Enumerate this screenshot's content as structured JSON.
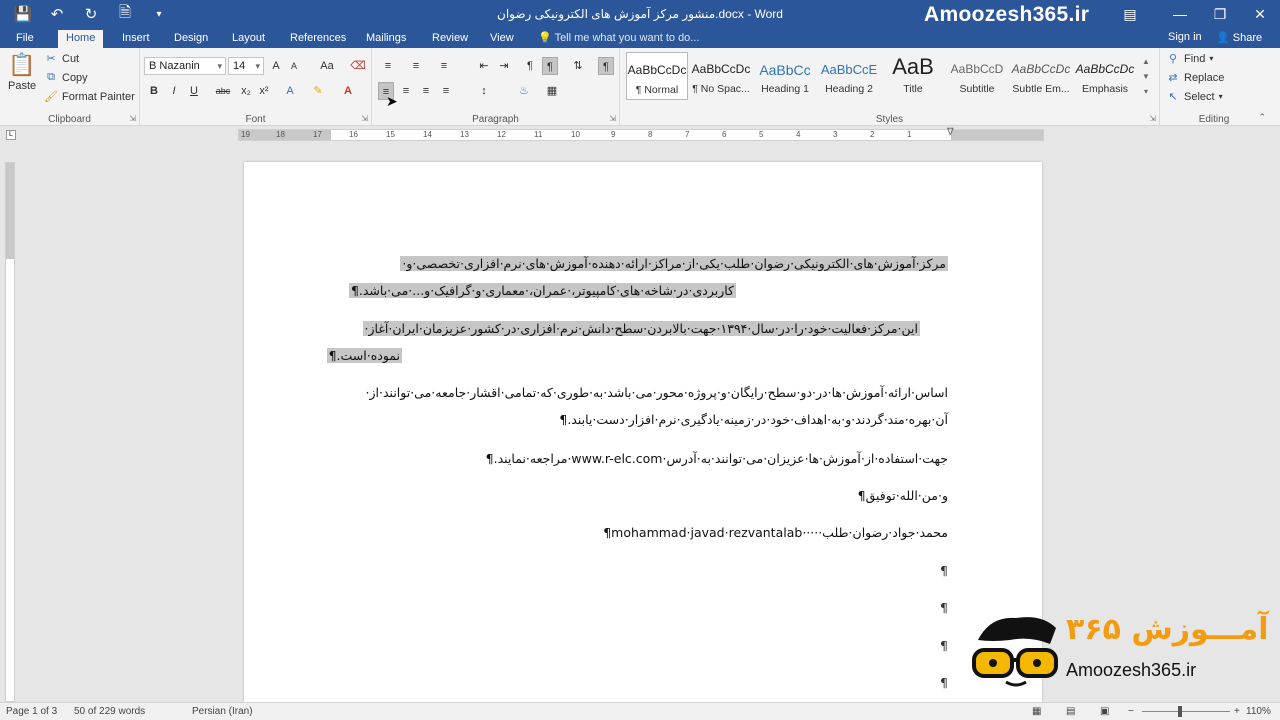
{
  "window": {
    "title": "منشور مرکز آموزش های الکترونیکی رضوان.docx - Word",
    "brand": "Amoozesh365.ir"
  },
  "qat": {
    "save_icon": "save-icon",
    "undo_icon": "undo-icon",
    "redo_icon": "redo-icon",
    "new_icon": "new-document-icon",
    "customize_icon": "customize-qat-icon"
  },
  "tabs": [
    "File",
    "Home",
    "Insert",
    "Design",
    "Layout",
    "References",
    "Mailings",
    "Review",
    "View"
  ],
  "active_tab": "Home",
  "tellme": "Tell me what you want to do...",
  "account": {
    "signin": "Sign in",
    "share": "Share"
  },
  "clipboard": {
    "paste": "Paste",
    "cut": "Cut",
    "copy": "Copy",
    "format_painter": "Format Painter",
    "label": "Clipboard"
  },
  "font": {
    "name": "B Nazanin",
    "size": "14",
    "label": "Font",
    "bold": "B",
    "italic": "I",
    "underline": "U",
    "strike": "abc",
    "subscript": "x₂",
    "superscript": "x²",
    "case": "Aa",
    "grow": "A",
    "shrink": "A"
  },
  "paragraph": {
    "label": "Paragraph",
    "show_marks": "¶"
  },
  "styles": {
    "label": "Styles",
    "items": [
      {
        "sample": "AaBbCcDc",
        "name": "¶ Normal"
      },
      {
        "sample": "AaBbCcDc",
        "name": "¶ No Spac..."
      },
      {
        "sample": "AaBbCc",
        "name": "Heading 1"
      },
      {
        "sample": "AaBbCcE",
        "name": "Heading 2"
      },
      {
        "sample": "AaB",
        "name": "Title"
      },
      {
        "sample": "AaBbCcD",
        "name": "Subtitle"
      },
      {
        "sample": "AaBbCcDc",
        "name": "Subtle Em..."
      },
      {
        "sample": "AaBbCcDc",
        "name": "Emphasis"
      }
    ]
  },
  "editing": {
    "label": "Editing",
    "find": "Find",
    "replace": "Replace",
    "select": "Select"
  },
  "ruler": {
    "numbers": [
      "19",
      "18",
      "17",
      "16",
      "15",
      "14",
      "13",
      "12",
      "11",
      "10",
      "9",
      "8",
      "7",
      "6",
      "5",
      "4",
      "3",
      "2",
      "1"
    ]
  },
  "document": {
    "lines": [
      {
        "text": "مرکز·آموزش·های·الکترونیکی·رضوان·طلب·یکی·از·مراکز·ارائه·دهنده·آموزش·های·نرم·افزاری·تخصصی·و·",
        "highlight": true
      },
      {
        "text": "کاربردی·در·شاخه·های·کامپیوتر،·عمران،·معماری·و·گرافیک·و...·می·باشد.¶",
        "highlight": true
      },
      {
        "text": "این·مرکز·فعالیت·خود·را·در·سال·۱۳۹۴·جهت·بالابردن·سطح·دانش·نرم·افزاری·در·کشور·عزیزمان·ایران·آغاز·",
        "highlight": true
      },
      {
        "text": "نموده·است.¶",
        "highlight": true
      },
      {
        "text": "اساس·ارائه·آموزش·ها·در·دو·سطح·رایگان·و·پروژه·محور·می·باشد·به·طوری·که·تمامی·اقشار·جامعه·می·توانند·از·",
        "highlight": false
      },
      {
        "text": "آن·بهره·مند·گردند·و·به·اهداف·خود·در·زمینه·یادگیری·نرم·افزار·دست·یابند.¶",
        "highlight": false
      },
      {
        "text": "جهت·استفاده·از·آموزش·ها·عزیزان·می·توانند·به·آدرس·www.r-elc.com·مراجعه·نمایند.¶",
        "highlight": false
      },
      {
        "text": "و·من·الله·توفیق¶",
        "highlight": false
      },
      {
        "text": "محمد·جواد·رضوان·طلب·····mohammad·javad·rezvantalab¶",
        "highlight": false
      },
      {
        "text": "¶",
        "highlight": false
      },
      {
        "text": "¶",
        "highlight": false
      },
      {
        "text": "¶",
        "highlight": false
      },
      {
        "text": "¶",
        "highlight": false
      }
    ]
  },
  "watermark": {
    "text": "Amoozesh365.ir",
    "fa": "آمـــوزش ۳۶۵"
  },
  "statusbar": {
    "page": "Page 1 of 3",
    "words": "50 of 229 words",
    "language": "Persian (Iran)",
    "zoom": "110%",
    "zoom_minus": "−",
    "zoom_plus": "+"
  }
}
